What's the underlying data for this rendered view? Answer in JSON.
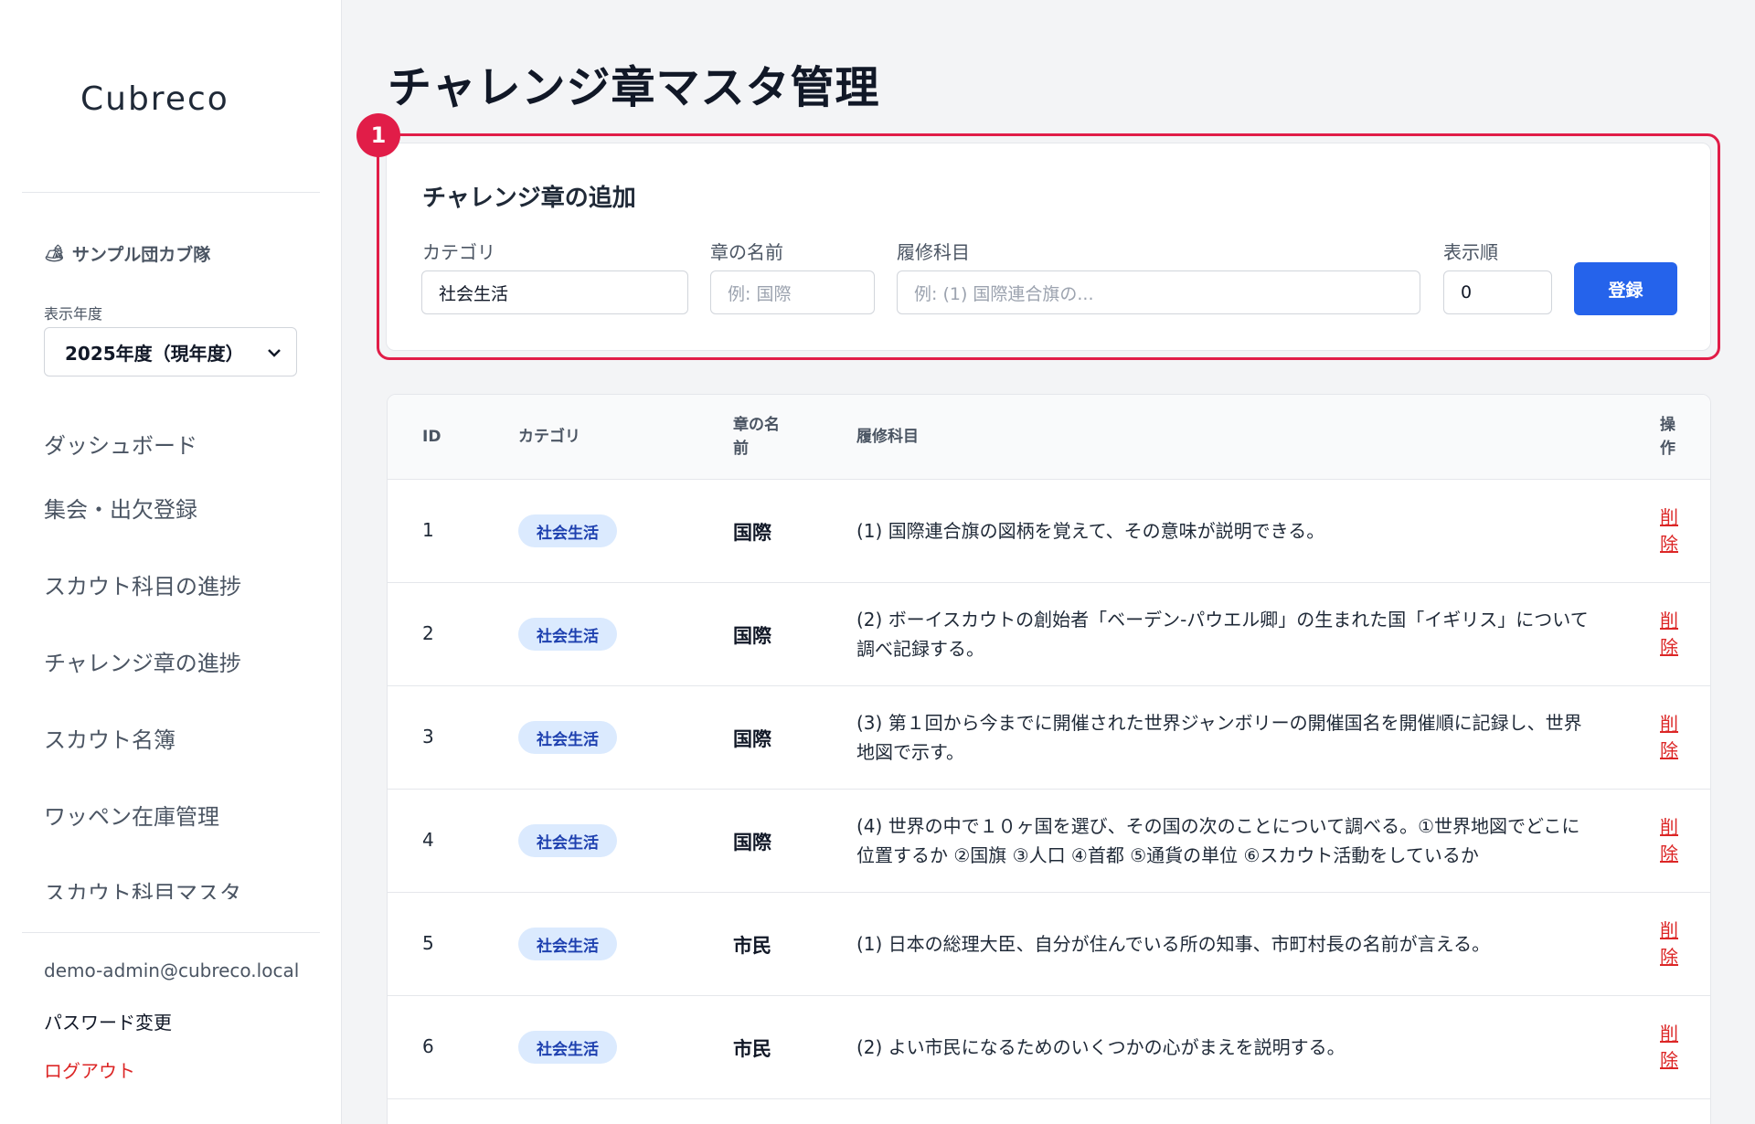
{
  "app": {
    "logo": "Cubreco"
  },
  "sidebar": {
    "troop_icon": "🏕",
    "troop_name": "サンプル団カブ隊",
    "year_label": "表示年度",
    "year_selected": "2025年度（現年度）",
    "nav": [
      {
        "label": "ダッシュボード"
      },
      {
        "label": "集会・出欠登録"
      },
      {
        "label": "スカウト科目の進捗"
      },
      {
        "label": "チャレンジ章の進捗"
      },
      {
        "label": "スカウト名簿"
      },
      {
        "label": "ワッペン在庫管理"
      },
      {
        "label": "スカウト科目マスタ"
      }
    ],
    "user_email": "demo-admin@cubreco.local",
    "password_change": "パスワード変更",
    "logout": "ログアウト"
  },
  "page": {
    "title": "チャレンジ章マスタ管理",
    "step_number": "1"
  },
  "add_form": {
    "title": "チャレンジ章の追加",
    "category_label": "カテゴリ",
    "category_value": "社会生活",
    "name_label": "章の名前",
    "name_placeholder": "例: 国際",
    "subject_label": "履修科目",
    "subject_placeholder": "例: (1) 国際連合旗の...",
    "order_label": "表示順",
    "order_value": "0",
    "submit_label": "登録"
  },
  "table": {
    "headers": {
      "id": "ID",
      "category": "カテゴリ",
      "name_l1": "章の名",
      "name_l2": "前",
      "subject": "履修科目",
      "op_l1": "操",
      "op_l2": "作"
    },
    "delete_l1": "削",
    "delete_l2": "除",
    "rows": [
      {
        "id": "1",
        "category": "社会生活",
        "name": "国際",
        "subject": "(1) 国際連合旗の図柄を覚えて、その意味が説明できる。"
      },
      {
        "id": "2",
        "category": "社会生活",
        "name": "国際",
        "subject": "(2) ボーイスカウトの創始者「ベーデン-パウエル卿」の生まれた国「イギリス」について調べ記録する。"
      },
      {
        "id": "3",
        "category": "社会生活",
        "name": "国際",
        "subject": "(3) 第１回から今までに開催された世界ジャンボリーの開催国名を開催順に記録し、世界地図で示す。"
      },
      {
        "id": "4",
        "category": "社会生活",
        "name": "国際",
        "subject": "(4) 世界の中で１０ヶ国を選び、その国の次のことについて調べる。①世界地図でどこに位置するか ②国旗 ③人口 ④首都 ⑤通貨の単位 ⑥スカウト活動をしているか"
      },
      {
        "id": "5",
        "category": "社会生活",
        "name": "市民",
        "subject": "(1) 日本の総理大臣、自分が住んでいる所の知事、市町村長の名前が言える。"
      },
      {
        "id": "6",
        "category": "社会生活",
        "name": "市民",
        "subject": "(2) よい市民になるためのいくつかの心がまえを説明する。"
      }
    ]
  }
}
